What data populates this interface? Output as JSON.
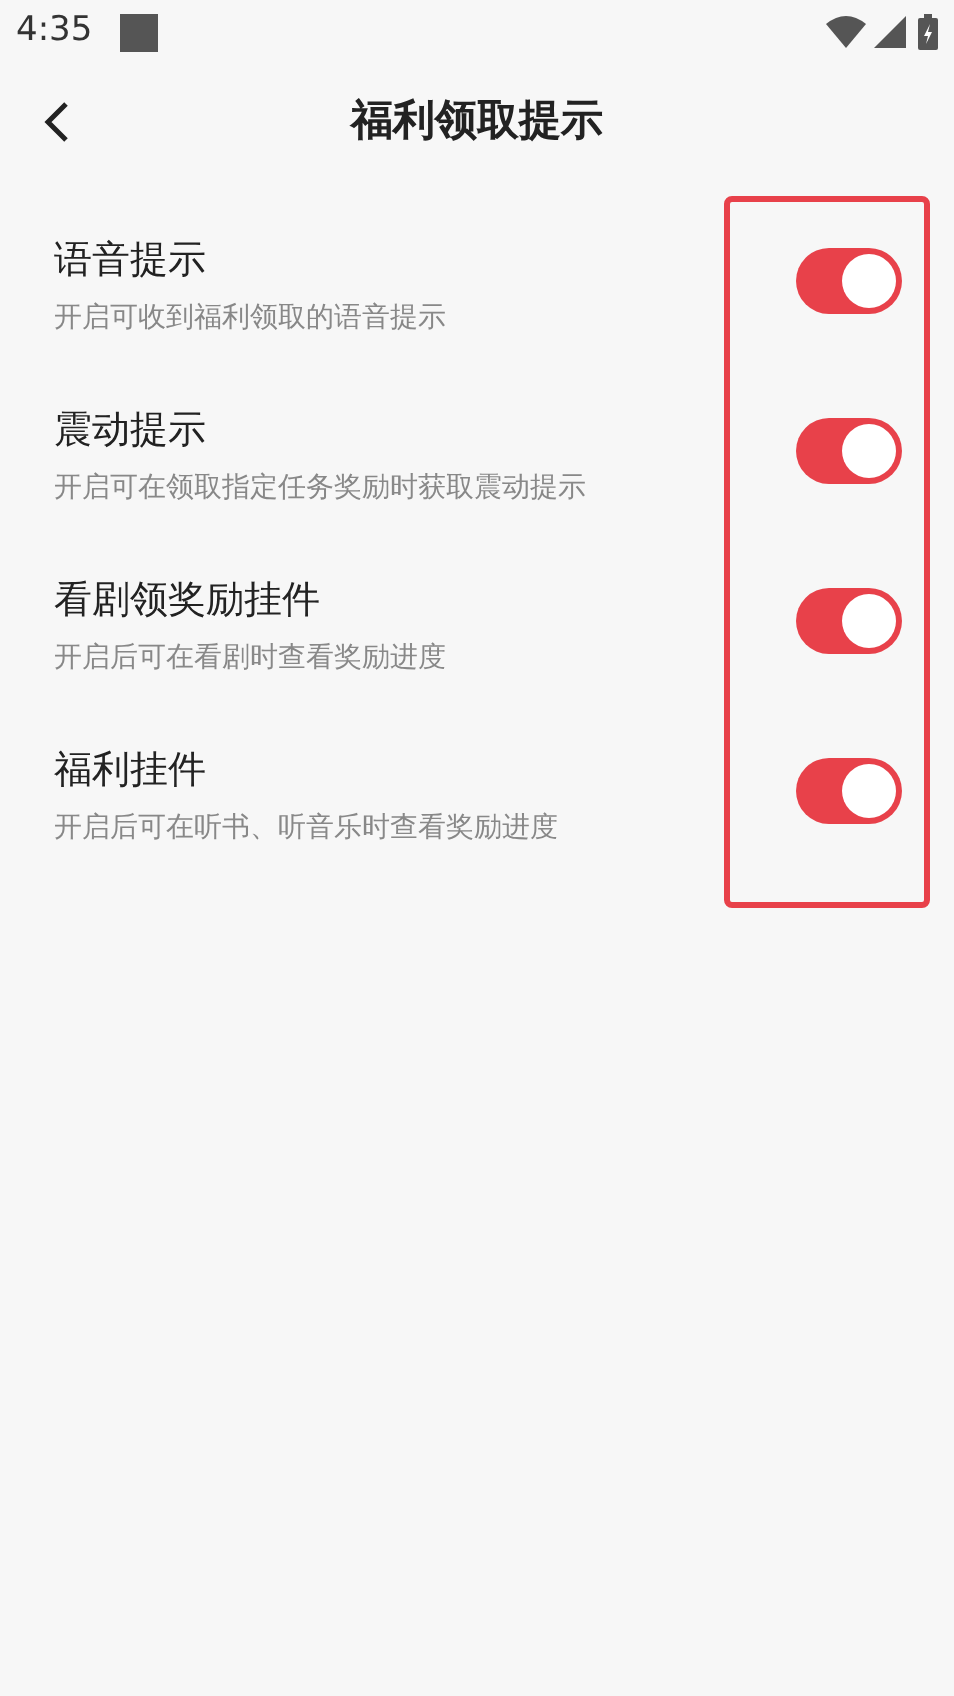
{
  "status_bar": {
    "time": "4:35"
  },
  "header": {
    "title": "福利领取提示"
  },
  "settings": [
    {
      "title": "语音提示",
      "description": "开启可收到福利领取的语音提示",
      "on": true
    },
    {
      "title": "震动提示",
      "description": "开启可在领取指定任务奖励时获取震动提示",
      "on": true
    },
    {
      "title": "看剧领奖励挂件",
      "description": "开启后可在看剧时查看奖励进度",
      "on": true
    },
    {
      "title": "福利挂件",
      "description": "开启后可在听书、听音乐时查看奖励进度",
      "on": true
    }
  ]
}
